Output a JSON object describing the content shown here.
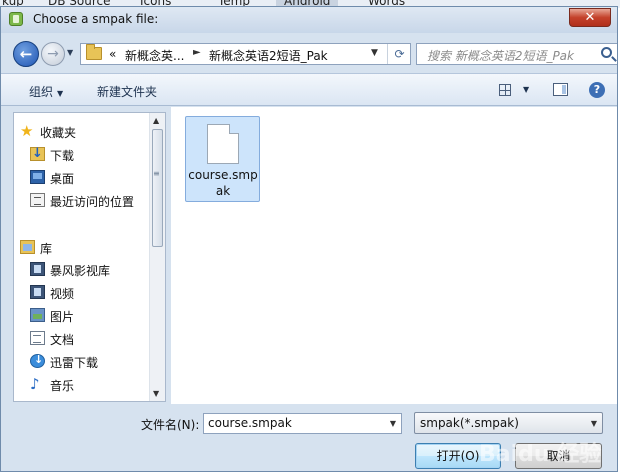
{
  "background_tabs": [
    "kup",
    "DB Source",
    "Icons",
    "Temp",
    "Android",
    "Words"
  ],
  "dialog": {
    "title": "Choose a smpak file:",
    "close_symbol": "✕"
  },
  "nav": {
    "back_symbol": "←",
    "forward_symbol": "→",
    "breadcrumb_overflow": "«",
    "breadcrumbs": [
      "新概念英...",
      "新概念英语2短语_Pak"
    ],
    "refresh_symbol": "⟳",
    "search_placeholder": "搜索 新概念英语2短语_Pak"
  },
  "toolbar": {
    "organize_label": "组织",
    "new_folder_label": "新建文件夹",
    "help_symbol": "?"
  },
  "navpane": {
    "favorites": {
      "label": "收藏夹",
      "icon": "star-icon",
      "items": [
        {
          "label": "下载",
          "icon": "download-folder-icon"
        },
        {
          "label": "桌面",
          "icon": "desktop-icon"
        },
        {
          "label": "最近访问的位置",
          "icon": "recent-places-icon"
        }
      ]
    },
    "libraries": {
      "label": "库",
      "icon": "library-icon",
      "items": [
        {
          "label": "暴风影视库",
          "icon": "video-library-icon"
        },
        {
          "label": "视频",
          "icon": "videos-icon"
        },
        {
          "label": "图片",
          "icon": "pictures-icon"
        },
        {
          "label": "文档",
          "icon": "documents-icon"
        },
        {
          "label": "迅雷下载",
          "icon": "xunlei-download-icon"
        },
        {
          "label": "音乐",
          "icon": "music-icon"
        }
      ]
    }
  },
  "files": [
    {
      "name": "course.smpak",
      "icon": "file-icon",
      "selected": true
    }
  ],
  "bottom": {
    "filename_label": "文件名(N):",
    "filename_value": "course.smpak",
    "filetype_value": "smpak(*.smpak)",
    "open_label": "打开(O)",
    "cancel_label": "取消",
    "watermark": "Baidu 经验"
  },
  "colors": {
    "dialog_bg": "#d6e2ef",
    "selection": "#cde4fb",
    "close_button": "#c4412b"
  }
}
